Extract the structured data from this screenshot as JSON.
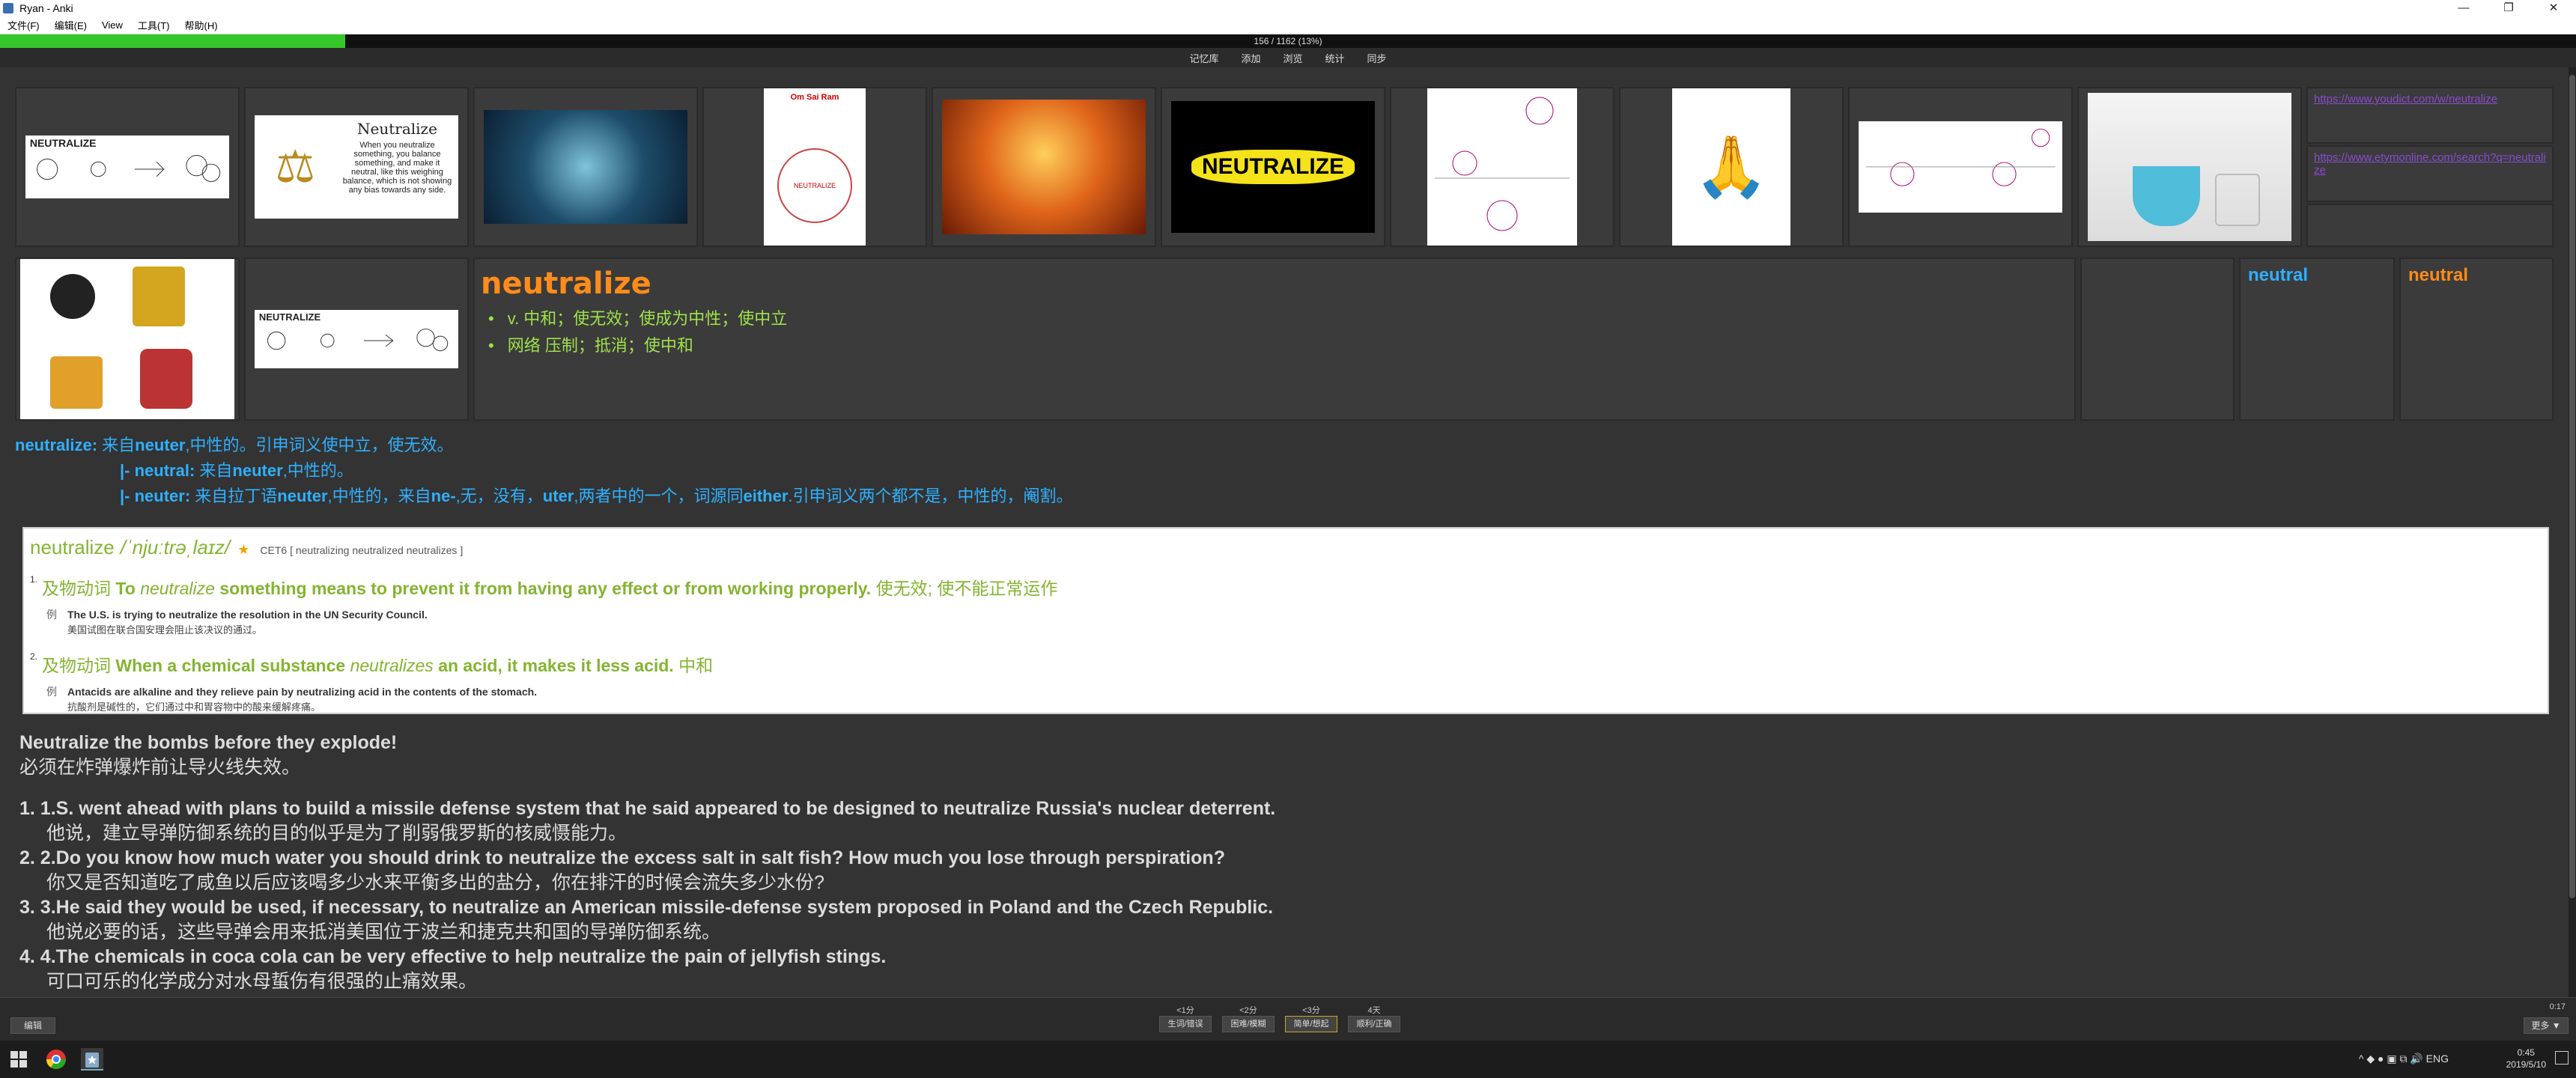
{
  "window": {
    "title": "Ryan - Anki",
    "controls": [
      "—",
      "❐",
      "✕"
    ]
  },
  "menu": [
    "文件(F)",
    "编辑(E)",
    "View",
    "工具(T)",
    "帮助(H)"
  ],
  "progress": {
    "text": "156 / 1162 (13%)",
    "fraction": 0.134
  },
  "toplinks": [
    "记忆库",
    "添加",
    "浏览",
    "统计",
    "同步"
  ],
  "urls": [
    "https://www.youdict.com/w/neutralize",
    "https://www.etymonline.com/search?q=neutralize"
  ],
  "images": {
    "neutralize_text": "NEUTRALIZE",
    "neutralize_card_title": "Neutralize",
    "neutralize_card_body": "When you neutralize something, you balance something, and make it neutral, like this weighing balance, which is not showing any bias towards any side.",
    "card_small_header": "Om Sai Ram",
    "card_small_circle": "NEUTRALIZE",
    "neutralize_banner": "NEUTRALIZE"
  },
  "card": {
    "word": "neutralize",
    "defs": [
      "v. 中和；使无效；使成为中性；使中立",
      "网络 压制；抵消；使中和"
    ],
    "neutral1": "neutral",
    "neutral2": "neutral"
  },
  "etym": {
    "l1_head": "neutralize:",
    "l1_text": " 来自",
    "l1_b": "neuter",
    "l1_rest": ",中性的。引申词义使中立，使无效。",
    "l2_head": "|- neutral:",
    "l2_text": " 来自",
    "l2_b": "neuter",
    "l2_rest": ",中性的。",
    "l3_head": "|- neuter:",
    "l3_a": " 来自拉丁语",
    "l3_b": "neuter",
    "l3_c": ",中性的，来自",
    "l3_d": "ne-",
    "l3_e": ",无，没有，",
    "l3_f": "uter",
    "l3_g": ",两者中的一个，词源同",
    "l3_h": "either",
    "l3_i": ".引申词义两个都不是，中性的，阉割。"
  },
  "dict": {
    "headword": "neutralize",
    "phonetic": "/ˈnjuːtrəˌlaɪz/",
    "star": "★",
    "tags": "CET6  [ neutralizing neutralized neutralizes ]",
    "s1_num": "1.",
    "s1_pos": "及物动词",
    "s1_a": " To ",
    "s1_i": "neutralize",
    "s1_b": " something means to prevent it from having any effect or from working properly.",
    "s1_cn": " 使无效; 使不能正常运作",
    "s1_ex_label": "例",
    "s1_ex_en": "The U.S. is trying to neutralize the resolution in the UN Security Council.",
    "s1_ex_cn": "美国试图在联合国安理会阻止该决议的通过。",
    "s2_num": "2.",
    "s2_pos": "及物动词",
    "s2_a": " When a chemical substance ",
    "s2_i": "neutralizes",
    "s2_b": " an acid, it makes it less acid.",
    "s2_cn": " 中和",
    "s2_ex_label": "例",
    "s2_ex_en": "Antacids are alkaline and they relieve pain by neutralizing acid in the contents of the stomach.",
    "s2_ex_cn": "抗酸剂是碱性的，它们通过中和胃容物中的酸来缓解疼痛。"
  },
  "sentences": {
    "head_en": "Neutralize the bombs before they explode!",
    "head_cn": "必须在炸弹爆炸前让导火线失效。",
    "items": [
      {
        "en": "1. 1.S. went ahead with plans to build a missile defense system that he said appeared to be designed to neutralize Russia's nuclear deterrent.",
        "cn": "他说，建立导弹防御系统的目的似乎是为了削弱俄罗斯的核威慑能力。"
      },
      {
        "en": "2. 2.Do you know how much water you should drink to neutralize the excess salt in salt fish? How much you lose through perspiration?",
        "cn": "你又是否知道吃了咸鱼以后应该喝多少水来平衡多出的盐分，你在排汗的时候会流失多少水份?"
      },
      {
        "en": "3. 3.He said they would be used, if necessary, to neutralize an American missile-defense system proposed in Poland and the Czech Republic.",
        "cn": "他说必要的话，这些导弹会用来抵消美国位于波兰和捷克共和国的导弹防御系统。"
      },
      {
        "en": "4. 4.The chemicals in coca cola can be very effective to help neutralize the pain of jellyfish stings.",
        "cn": "可口可乐的化学成分对水母蜇伤有很强的止痛效果。"
      }
    ]
  },
  "bottom": {
    "edit": "编辑",
    "answers": [
      {
        "time": "<1分",
        "label": "生词/错误"
      },
      {
        "time": "<2分",
        "label": "困难/模糊"
      },
      {
        "time": "<3分",
        "label": "简单/想起"
      },
      {
        "time": "4天",
        "label": "顺利/正确"
      }
    ],
    "more": "更多 ▼",
    "timer": "0:17"
  },
  "taskbar": {
    "lang": "ENG",
    "time": "0:45",
    "date": "2019/5/10"
  }
}
